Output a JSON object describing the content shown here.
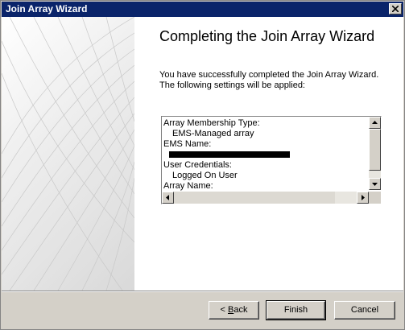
{
  "window": {
    "title": "Join Array Wizard"
  },
  "heading": "Completing the Join Array Wizard",
  "intro": "You have successfully completed the Join Array Wizard. The following settings will be applied:",
  "settings": {
    "membership_label": "Array Membership Type:",
    "membership_value": "EMS-Managed array",
    "ems_label": "EMS Name:",
    "ems_value": "[redacted]",
    "credentials_label": "User Credentials:",
    "credentials_value": "Logged On User",
    "array_name_label": "Array Name:"
  },
  "buttons": {
    "back_prefix": "< ",
    "back_accel": "B",
    "back_rest": "ack",
    "finish": "Finish",
    "cancel": "Cancel"
  },
  "icons": [
    "close-icon",
    "arrow-up-icon",
    "arrow-down-icon",
    "arrow-left-icon",
    "arrow-right-icon"
  ],
  "colors": {
    "titlebar": "#0a246a",
    "dialog": "#d4d0c8",
    "panel": "#ffffff"
  }
}
